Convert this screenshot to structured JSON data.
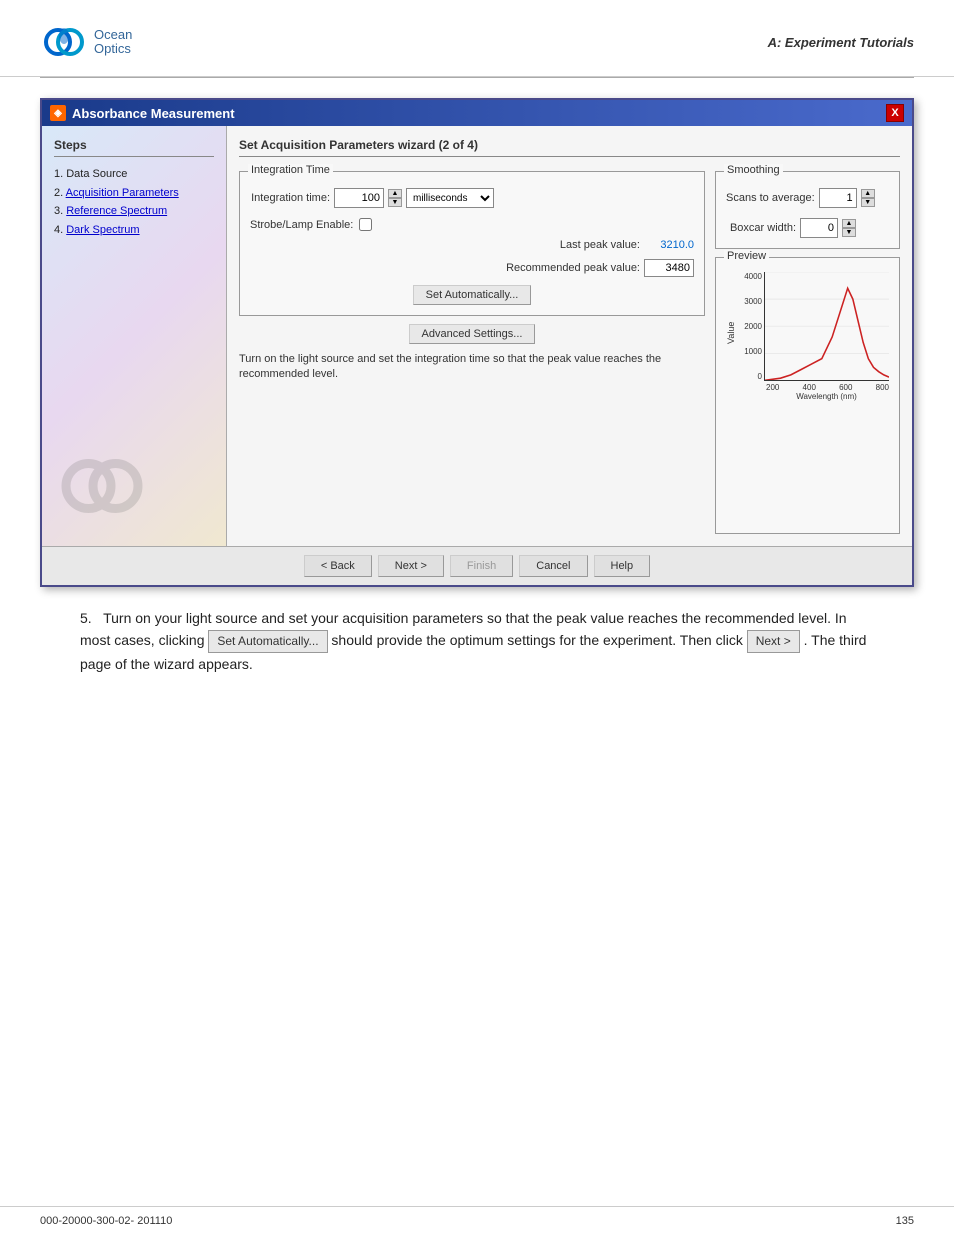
{
  "header": {
    "logo_line1": "Ocean",
    "logo_line2": "Optics",
    "section_title": "A: Experiment Tutorials"
  },
  "dialog": {
    "title": "Absorbance Measurement",
    "close_btn_label": "X",
    "steps_title": "Steps",
    "steps": [
      {
        "number": "1.",
        "label": "Data Source"
      },
      {
        "number": "2.",
        "label": "Acquisition Parameters"
      },
      {
        "number": "3.",
        "label": "Reference Spectrum"
      },
      {
        "number": "4.",
        "label": "Dark Spectrum"
      }
    ],
    "wizard_title": "Set Acquisition Parameters wizard (2 of 4)",
    "integration_time_group": "Integration Time",
    "integration_label": "Integration time:",
    "integration_value": "100",
    "integration_unit": "milliseconds",
    "strobe_label": "Strobe/Lamp Enable:",
    "last_peak_label": "Last peak value:",
    "last_peak_value": "3210.0",
    "recommended_peak_label": "Recommended peak value:",
    "recommended_peak_value": "3480",
    "set_automatically_btn": "Set Automatically...",
    "advanced_settings_btn": "Advanced Settings...",
    "instruction": "Turn on the light source and set the integration time so that the peak value reaches the recommended level.",
    "smoothing_group": "Smoothing",
    "scans_label": "Scans to average:",
    "scans_value": "1",
    "boxcar_label": "Boxcar width:",
    "boxcar_value": "0",
    "preview_group": "Preview",
    "chart_y_label": "Value",
    "chart_y_ticks": [
      "4000",
      "3000",
      "2000",
      "1000",
      "0"
    ],
    "chart_x_ticks": [
      "200",
      "400",
      "600",
      "800"
    ],
    "chart_x_label": "Wavelength (nm)",
    "footer_back_btn": "< Back",
    "footer_next_btn": "Next >",
    "footer_finish_btn": "Finish",
    "footer_cancel_btn": "Cancel",
    "footer_help_btn": "Help"
  },
  "paragraph": {
    "number": "5.",
    "text_before_btn1": "Turn on your light source and set your acquisition parameters so that the peak value reaches the recommended level. In most cases, clicking ",
    "inline_btn1": "Set Automatically...",
    "text_between": " should provide the optimum settings for the experiment. Then click ",
    "inline_btn2": "Next >",
    "text_after": ". The third page of the wizard appears."
  },
  "footer": {
    "left_text": "000-20000-300-02- 201110",
    "right_text": "135"
  }
}
